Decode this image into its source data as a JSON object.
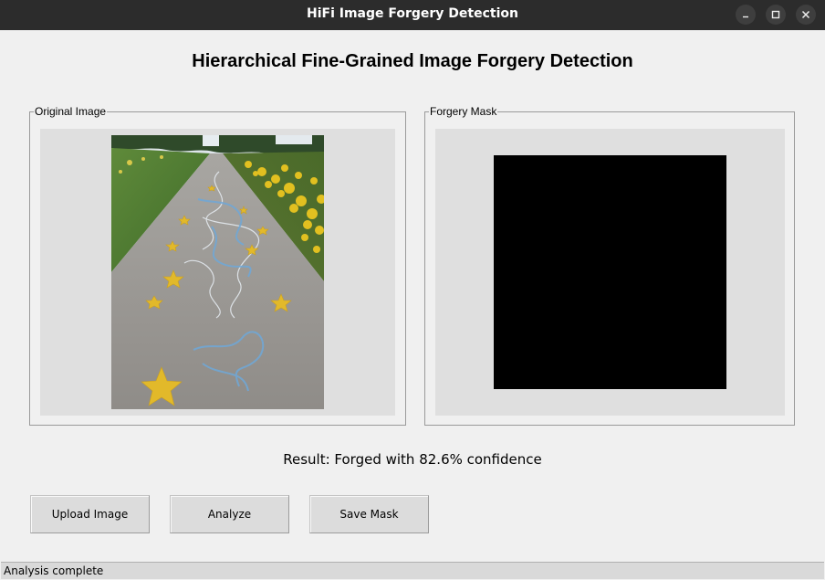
{
  "window": {
    "title": "HiFi Image Forgery Detection"
  },
  "main": {
    "heading": "Hierarchical Fine-Grained Image Forgery Detection",
    "original_frame": {
      "label": "Original Image"
    },
    "mask_frame": {
      "label": "Forgery Mask"
    },
    "result_text": "Result: Forged with 82.6% confidence"
  },
  "buttons": {
    "upload": "Upload Image",
    "analyze": "Analyze",
    "save_mask": "Save Mask"
  },
  "status": {
    "text": "Analysis complete"
  },
  "colors": {
    "titlebar": "#2c2c2c",
    "window_bg": "#f0f0f0",
    "image_area_bg": "#dfdfdf",
    "mask": "#000000",
    "button_bg": "#dcdcdc",
    "statusbar_bg": "#d9d9d9"
  },
  "icons": [
    "minimize-icon",
    "maximize-icon",
    "close-icon"
  ]
}
